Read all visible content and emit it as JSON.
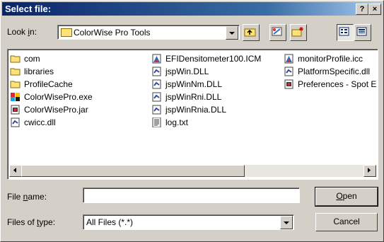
{
  "window": {
    "title": "Select file:",
    "help_label": "?",
    "close_label": "×"
  },
  "lookin": {
    "label_pre": "Look ",
    "label_u": "i",
    "label_post": "n:",
    "value": "ColorWise Pro Tools"
  },
  "files": [
    {
      "name": "com",
      "icon": "folder-icon"
    },
    {
      "name": "libraries",
      "icon": "folder-icon"
    },
    {
      "name": "ProfileCache",
      "icon": "folder-icon"
    },
    {
      "name": "ColorWisePro.exe",
      "icon": "app-icon"
    },
    {
      "name": "ColorWisePro.jar",
      "icon": "jar-icon"
    },
    {
      "name": "cwicc.dll",
      "icon": "dll-icon"
    },
    {
      "name": "EFIDensitometer100.ICM",
      "icon": "icm-icon"
    },
    {
      "name": "jspWin.DLL",
      "icon": "dll-icon"
    },
    {
      "name": "jspWinNm.DLL",
      "icon": "dll-icon"
    },
    {
      "name": "jspWinRni.DLL",
      "icon": "dll-icon"
    },
    {
      "name": "jspWinRnia.DLL",
      "icon": "dll-icon"
    },
    {
      "name": "log.txt",
      "icon": "text-file-icon"
    },
    {
      "name": "monitorProfile.icc",
      "icon": "icm-icon"
    },
    {
      "name": "PlatformSpecific.dll",
      "icon": "dll-icon"
    },
    {
      "name": "Preferences - Spot E",
      "icon": "jar-icon"
    }
  ],
  "filename": {
    "label_pre": "File ",
    "label_u": "n",
    "label_post": "ame:",
    "value": ""
  },
  "filetype": {
    "label_pre": "Files of ",
    "label_u": "t",
    "label_post": "ype:",
    "value": "All Files (*.*)"
  },
  "buttons": {
    "open_u": "O",
    "open_rest": "pen",
    "cancel": "Cancel"
  },
  "colors": {
    "title_start": "#0a246a",
    "title_end": "#a6caf0",
    "face": "#d4d0c8"
  }
}
